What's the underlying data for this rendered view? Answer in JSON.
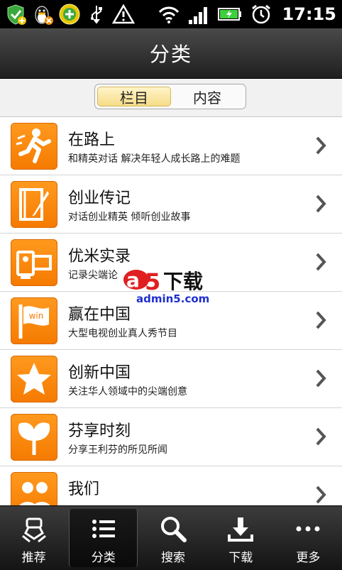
{
  "status_bar": {
    "time": "17:15",
    "icons_left": [
      "shield-plus-icon",
      "qq-penguin-icon",
      "plus-circle-icon",
      "usb-icon",
      "warning-icon"
    ],
    "icons_right": [
      "wifi-icon",
      "signal-icon",
      "battery-icon",
      "alarm-clock-icon"
    ]
  },
  "header": {
    "title": "分类"
  },
  "segmented": {
    "options": [
      {
        "label": "栏目",
        "selected": true
      },
      {
        "label": "内容",
        "selected": false
      }
    ]
  },
  "list": {
    "items": [
      {
        "title": "在路上",
        "subtitle": "和精英对话 解决年轻人成长路上的难题",
        "icon": "runner-icon"
      },
      {
        "title": "创业传记",
        "subtitle": "对话创业精英 倾听创业故事",
        "icon": "notebook-pen-icon"
      },
      {
        "title": "优米实录",
        "subtitle": "记录尖端论",
        "icon": "video-camera-icon"
      },
      {
        "title": "赢在中国",
        "subtitle": "大型电视创业真人秀节目",
        "icon": "win-flag-icon"
      },
      {
        "title": "创新中国",
        "subtitle": "关注华人领域中的尖端创意",
        "icon": "star-icon"
      },
      {
        "title": "芬享时刻",
        "subtitle": "分享王利芬的所见所闻",
        "icon": "ginkgo-leaf-icon"
      },
      {
        "title": "我们",
        "subtitle": "",
        "icon": "people-icon"
      }
    ]
  },
  "watermark": {
    "text": "下载",
    "url": "admin5.com",
    "logo": "a5"
  },
  "tabbar": {
    "tabs": [
      {
        "label": "推荐",
        "icon": "recommend-hand-icon",
        "active": false
      },
      {
        "label": "分类",
        "icon": "list-icon",
        "active": true
      },
      {
        "label": "搜索",
        "icon": "search-icon",
        "active": false
      },
      {
        "label": "下载",
        "icon": "download-icon",
        "active": false
      },
      {
        "label": "更多",
        "icon": "more-dots-icon",
        "active": false
      }
    ]
  },
  "colors": {
    "accent_orange": "#f57a00",
    "selected_segment": "#f6dc88",
    "tabbar_bg": "#1f1f1f"
  }
}
